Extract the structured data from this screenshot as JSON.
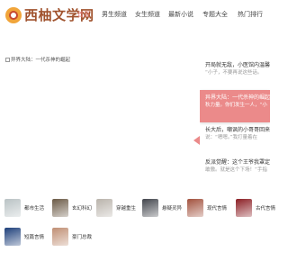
{
  "header": {
    "site_title": "西柚文学网",
    "logo": "orange-logo-icon"
  },
  "nav": {
    "items": [
      "首页",
      "男生频道",
      "女生频道",
      "最新小说",
      "专题大全",
      "热门排行"
    ],
    "active_index": 0
  },
  "hero": {
    "alt_text": "异界大陆：一代杀神的崛起"
  },
  "list": {
    "items": [
      {
        "title": "开局就无敌，小医馆内温馨",
        "subtitle": "“小子，不要再说这些话。"
      },
      {
        "title": "异界大陆：一代杀神的崛起",
        "subtitle": "秋力量。你们发生一人，“小"
      },
      {
        "title": "长大后，嘲讽的小哥哥回来",
        "subtitle": "说：“嗯嗯。”我打量着在"
      },
      {
        "title": "反派觉醒：这个王爷我罩定",
        "subtitle": "敢傲。就是这个下场！”手指"
      }
    ],
    "selected_index": 1
  },
  "categories": [
    {
      "label": "都市生活",
      "thumb_color": "#b9c2c4"
    },
    {
      "label": "玄幻科幻",
      "thumb_color": "#6b5a46"
    },
    {
      "label": "穿越重生",
      "thumb_color": "#b9b3ab"
    },
    {
      "label": "悬疑灵异",
      "thumb_color": "#42454c"
    },
    {
      "label": "现代言情",
      "thumb_color": "#a2513d"
    },
    {
      "label": "古代言情",
      "thumb_color": "#8b1e24"
    },
    {
      "label": "短篇言情",
      "thumb_color": "#1d3f7a"
    },
    {
      "label": "豪门总裁",
      "thumb_color": "#c08f74"
    }
  ]
}
